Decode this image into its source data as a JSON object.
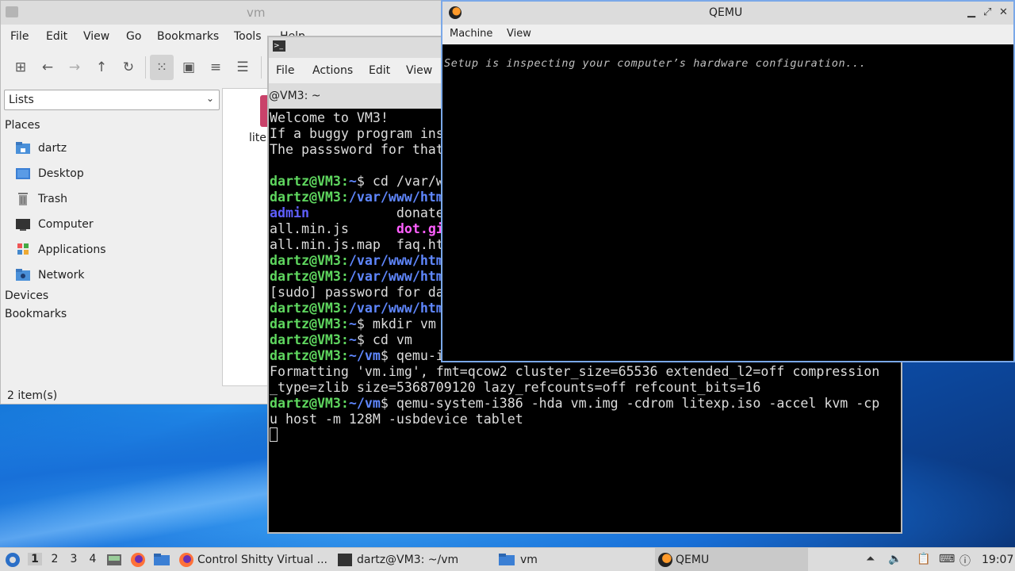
{
  "file_manager": {
    "title": "vm",
    "menu": [
      "File",
      "Edit",
      "View",
      "Go",
      "Bookmarks",
      "Tools",
      "Help"
    ],
    "view_combo": "Lists",
    "places_header": "Places",
    "places": [
      "dartz",
      "Desktop",
      "Trash",
      "Computer",
      "Applications",
      "Network"
    ],
    "devices_header": "Devices",
    "bookmarks_header": "Bookmarks",
    "file_label": "lite",
    "status": "2 item(s)"
  },
  "terminal": {
    "menu": [
      "File",
      "Actions",
      "Edit",
      "View"
    ],
    "tab_label": "@VM3: ~",
    "lines": [
      "Welcome to VM3!",
      "If a buggy program ins",
      "The passsword for that",
      "",
      "dartz@VM3:~$ cd /var/w",
      "dartz@VM3:/var/www/htm",
      "admin           donate",
      "all.min.js      dot.gi",
      "all.min.js.map  faq.ht",
      "dartz@VM3:/var/www/htm",
      "dartz@VM3:/var/www/htm",
      "[sudo] password for da",
      "dartz@VM3:/var/www/htm",
      "dartz@VM3:~$ mkdir vm",
      "dartz@VM3:~$ cd vm",
      "dartz@VM3:~/vm$ qemu-i",
      "Formatting 'vm.img', fmt=qcow2 cluster_size=65536 extended_l2=off compression",
      "_type=zlib size=5368709120 lazy_refcounts=off refcount_bits=16",
      "dartz@VM3:~/vm$ qemu-system-i386 -hda vm.img -cdrom litexp.iso -accel kvm -cp",
      "u host -m 128M -usbdevice tablet"
    ]
  },
  "qemu": {
    "title": "QEMU",
    "menu": [
      "Machine",
      "View"
    ],
    "screen_text": "Setup is inspecting your computer’s hardware configuration..."
  },
  "taskbar": {
    "workspaces": [
      "1",
      "2",
      "3",
      "4"
    ],
    "tasks": [
      "Control Shitty Virtual ...",
      "dartz@VM3: ~/vm",
      "vm",
      "QEMU"
    ],
    "clock": "19:07"
  },
  "colors": {
    "prompt_user": "#5fd75f",
    "prompt_path": "#5f87ff",
    "qemu_border": "#7aa8e8"
  }
}
